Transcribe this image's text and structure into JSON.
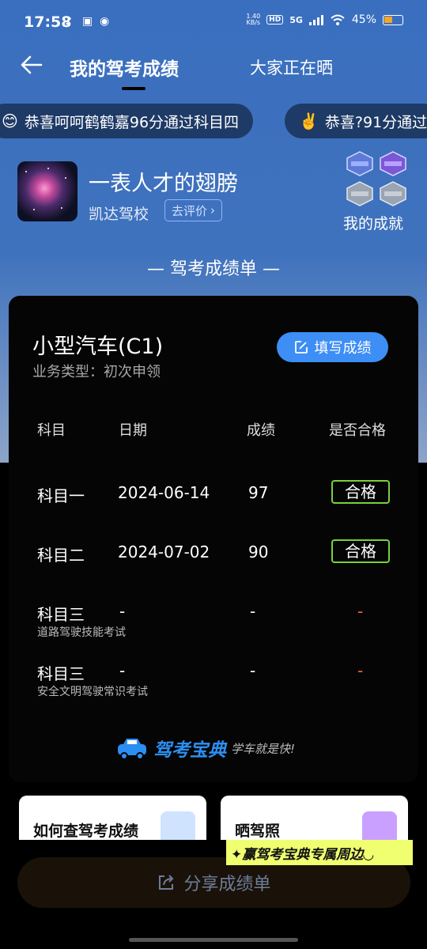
{
  "status_bar": {
    "time": "17:58",
    "net_speed_top": "1.40",
    "net_speed_unit": "KB/s",
    "hd": "HD",
    "signal": "5G",
    "battery": "45%"
  },
  "nav": {
    "title": "我的驾考成绩",
    "tab2": "大家正在晒"
  },
  "marquee": [
    {
      "emoji": "😊",
      "text": "恭喜呵呵鹤鹤嘉96分通过科目四"
    },
    {
      "emoji": "✌️",
      "text": "恭喜?91分通过"
    }
  ],
  "profile": {
    "name": "一表人才的翅膀",
    "school": "凯达驾校",
    "review_label": "去评价",
    "achievement_label": "我的成就"
  },
  "section_title": "— 驾考成绩单 —",
  "card": {
    "car_type": "小型汽车(C1)",
    "business_type": "业务类型：初次申领",
    "fill_button": "填写成绩",
    "headers": {
      "subject": "科目",
      "date": "日期",
      "score": "成绩",
      "passed": "是否合格"
    },
    "rows": [
      {
        "subject": "科目一",
        "sub": "",
        "date": "2024-06-14",
        "score": "97",
        "passed": "合格"
      },
      {
        "subject": "科目二",
        "sub": "",
        "date": "2024-07-02",
        "score": "90",
        "passed": "合格"
      },
      {
        "subject": "科目三",
        "sub": "道路驾驶技能考试",
        "date": "-",
        "score": "-",
        "passed": "-"
      },
      {
        "subject": "科目三",
        "sub": "安全文明驾驶常识考试",
        "date": "-",
        "score": "-",
        "passed": "-"
      }
    ],
    "brand_name": "驾考宝典",
    "brand_slogan": "学车就是快!"
  },
  "cards_below": [
    {
      "label": "如何查驾考成绩"
    },
    {
      "label": "晒驾照"
    }
  ],
  "promo": "✦赢驾考宝典专属周边◡",
  "share_button": "分享成绩单",
  "colors": {
    "header_blue": "#3a6fc0",
    "accent_blue": "#3d8ef5",
    "pass_green": "#7ad03c",
    "dash_red": "#ff6633"
  }
}
